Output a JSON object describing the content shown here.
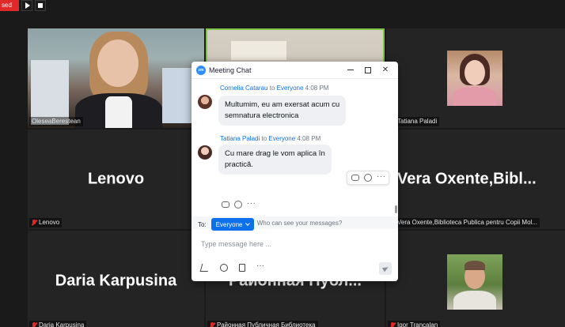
{
  "recording": {
    "label": "sed"
  },
  "tiles": {
    "olesea": {
      "name": "OleseaBerestean"
    },
    "tatiana": {
      "name": "Tatiana Paladi"
    },
    "lenovo": {
      "big": "Lenovo",
      "name": "Lenovo"
    },
    "vera": {
      "big": "Vera  Oxente,Bibl...",
      "name": "Vera Oxente,Biblioteca Publica pentru Copii Mol..."
    },
    "daria": {
      "big": "Daria Karpusina",
      "name": "Daria Karpusina"
    },
    "raion": {
      "big": "Районная Публ...",
      "name": "Районная Публичная Библиотека"
    },
    "igor": {
      "name": "Igor Trancalan"
    }
  },
  "chat": {
    "title": "Meeting Chat",
    "messages": [
      {
        "sender": "Cornelia Catarau",
        "to_word": "to",
        "recipient": "Everyone",
        "time": "4:08 PM",
        "lines": [
          "Multumim, eu am exersat acum cu",
          "semnatura electronica"
        ]
      },
      {
        "sender": "Tatiana Paladi",
        "to_word": "to",
        "recipient": "Everyone",
        "time": "4:08 PM",
        "lines": [
          "Cu mare drag le vom aplica în",
          "practică."
        ]
      }
    ],
    "privacy_text": "Who can see your messages?",
    "to_label": "To:",
    "to_value": "Everyone",
    "input_placeholder": "Type message here ..."
  },
  "icons": {
    "play": "play-icon",
    "stop": "stop-icon",
    "chat_logo": "zoom-logo-icon",
    "minimize": "minimize-icon",
    "maximize": "maximize-icon",
    "close": "close-icon",
    "reply": "reply-icon",
    "emoji": "emoji-icon",
    "more": "more-icon",
    "person": "person-icon",
    "format": "format-icon",
    "file": "file-icon",
    "send": "send-icon",
    "mic_muted": "mic-muted-icon"
  },
  "colors": {
    "accent": "#0e71eb",
    "record": "#e02828",
    "active_speaker": "#7ec34a"
  }
}
